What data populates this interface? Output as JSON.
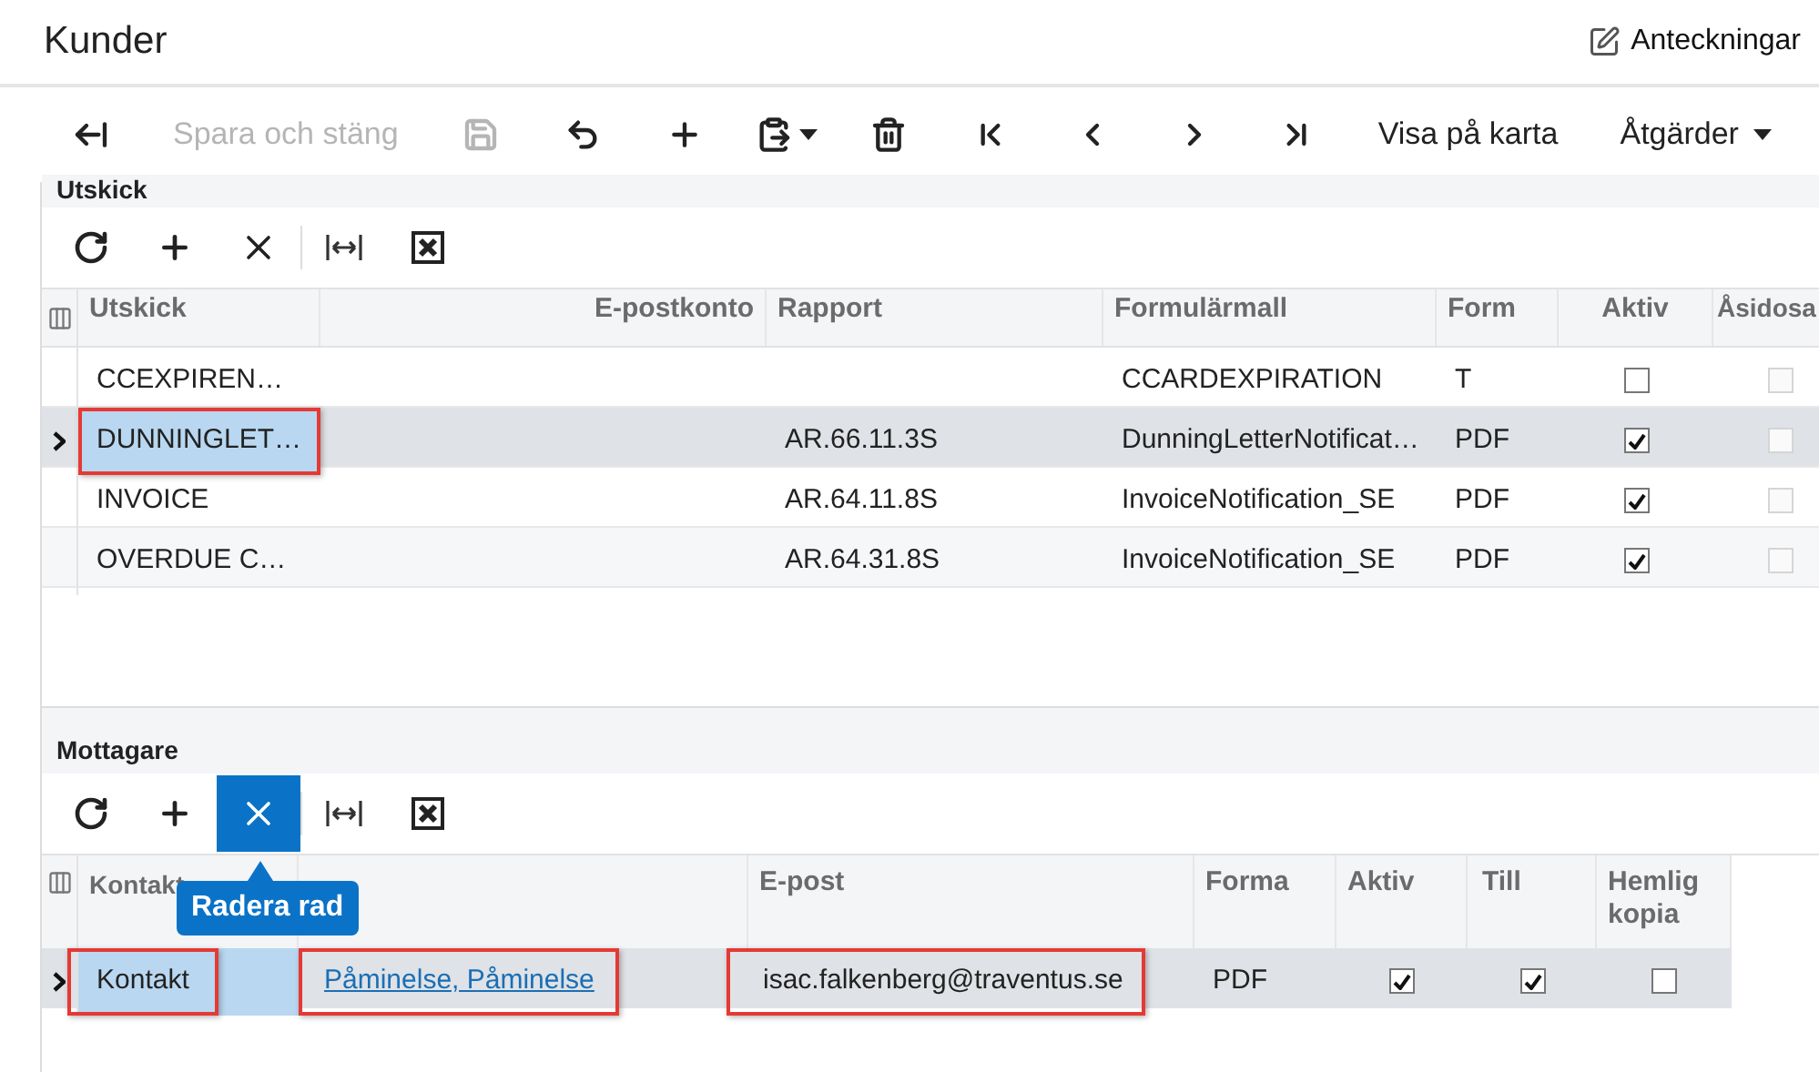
{
  "title": "Kunder",
  "notes_link": "Anteckningar",
  "toolbar": [
    {
      "kind": "icon",
      "disabled": false
    },
    {
      "kind": "text",
      "label": "Spara och stäng",
      "disabled": true
    },
    {
      "kind": "icon",
      "disabled": true
    },
    {
      "kind": "icon",
      "disabled": false
    },
    {
      "kind": "icon",
      "disabled": false
    },
    {
      "kind": "dropdown-icon",
      "disabled": false
    },
    {
      "kind": "icon",
      "disabled": false
    },
    {
      "kind": "icon",
      "disabled": false
    },
    {
      "kind": "icon",
      "disabled": false
    },
    {
      "kind": "icon",
      "disabled": false
    },
    {
      "kind": "icon",
      "disabled": false
    },
    {
      "kind": "text",
      "label": "Visa på karta",
      "disabled": false
    },
    {
      "kind": "dropdown-text",
      "label": "Åtgärder",
      "disabled": false
    }
  ],
  "utskick": {
    "title": "Utskick",
    "tools": [
      {
        "active": false
      },
      {
        "active": false
      },
      {
        "active": false
      },
      {
        "active": false
      },
      {
        "active": false
      }
    ],
    "columns": [
      "Utskick",
      "E-postkonto",
      "Rapport",
      "Formulärmall",
      "Form",
      "Aktiv",
      "Åsidosa"
    ],
    "rows": [
      {
        "selected": false,
        "name": {
          "text": "CCEXPIREN…",
          "outlined": false
        },
        "template": "CCARDEXPIRATION",
        "format": "T",
        "active": false,
        "override": false
      },
      {
        "selected": true,
        "name": {
          "text": "DUNNINGLET…",
          "outlined": true
        },
        "report": "AR.66.11.3S",
        "template": "DunningLetterNotificat…",
        "format": "PDF",
        "active": true,
        "override": false
      },
      {
        "selected": false,
        "name": {
          "text": "INVOICE",
          "outlined": false
        },
        "report": "AR.64.11.8S",
        "template": "InvoiceNotification_SE",
        "format": "PDF",
        "active": true,
        "override": false
      },
      {
        "selected": false,
        "name": {
          "text": "OVERDUE C…",
          "outlined": false
        },
        "report": "AR.64.31.8S",
        "template": "InvoiceNotification_SE",
        "format": "PDF",
        "active": true,
        "override": false
      }
    ]
  },
  "mottagare": {
    "title": "Mottagare",
    "tools": [
      {
        "active": false
      },
      {
        "active": false
      },
      {
        "active": true
      },
      {
        "active": false
      },
      {
        "active": false
      }
    ],
    "tooltip": "Radera rad",
    "columns": [
      "Kontakt",
      "E-post",
      "Forma",
      "Aktiv",
      "Till",
      "Hemlig kopia"
    ],
    "rows": [
      {
        "selected": true,
        "contact": {
          "text": "Kontakt",
          "outlined": true
        },
        "name": {
          "text": "Påminelse, Påminelse",
          "outlined": true
        },
        "email": {
          "text": "isac.falkenberg@traventus.se",
          "outlined": true
        },
        "format": "PDF",
        "active": true,
        "to": true,
        "bcc": false
      }
    ]
  }
}
